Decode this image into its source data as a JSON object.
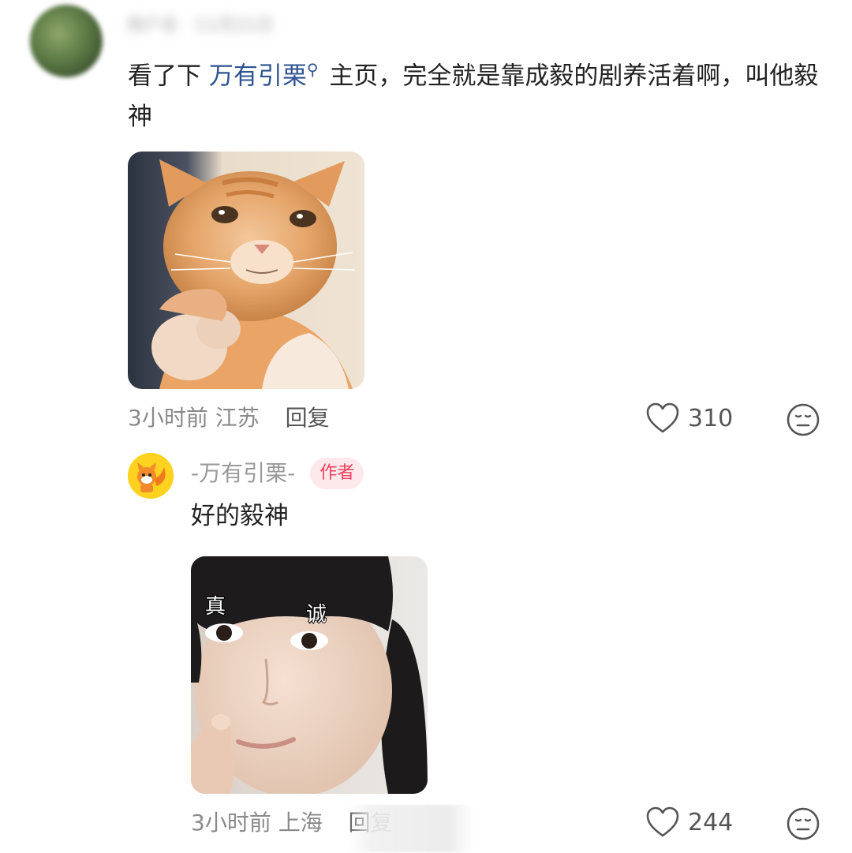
{
  "comment": {
    "username_blurred": "用户名 · 11月21日",
    "text_prefix": "看了下 ",
    "mention": "万有引栗",
    "mention_icon": "search-icon",
    "text_suffix": " 主页，完全就是靠成毅的剧养活着啊，叫他毅神",
    "image_alt": "orange cat pointing sticker",
    "time": "3小时前",
    "location": "江苏",
    "reply_label": "回复",
    "likes": "310"
  },
  "reply": {
    "username": "-万有引栗-",
    "badge": "作者",
    "text": "好的毅神",
    "image_caption_left": "真",
    "image_caption_right": "诚",
    "time": "3小时前",
    "location": "上海",
    "reply_label": "回复",
    "likes": "244"
  },
  "colors": {
    "mention": "#2d5391",
    "badge_text": "#f0405c",
    "badge_bg": "#fde9ec",
    "meta": "#8a8a8a",
    "avatar_yellow": "#ffd21f"
  }
}
